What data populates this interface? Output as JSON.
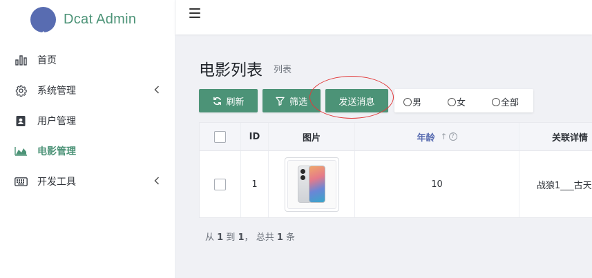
{
  "brand": {
    "name": "Dcat Admin"
  },
  "sidebar": {
    "items": [
      {
        "label": "首页",
        "icon": "bar-chart-icon",
        "active": false,
        "has_children": false
      },
      {
        "label": "系统管理",
        "icon": "gear-icon",
        "active": false,
        "has_children": true
      },
      {
        "label": "用户管理",
        "icon": "contact-book-icon",
        "active": false,
        "has_children": false
      },
      {
        "label": "电影管理",
        "icon": "area-chart-icon",
        "active": true,
        "has_children": false
      },
      {
        "label": "开发工具",
        "icon": "keyboard-icon",
        "active": false,
        "has_children": true
      }
    ]
  },
  "page": {
    "title": "电影列表",
    "subtitle": "列表"
  },
  "toolbar": {
    "refresh_label": "刷新",
    "filter_label": "筛选",
    "send_label": "发送消息",
    "radios": [
      "男",
      "女",
      "全部"
    ]
  },
  "table": {
    "headers": {
      "id": "ID",
      "image": "图片",
      "age": "年龄",
      "related": "关联详情"
    },
    "rows": [
      {
        "id": "1",
        "age": "10",
        "related": "战狼1___古天"
      }
    ]
  },
  "pagination": {
    "prefix": "从",
    "from": "1",
    "to_word": "到",
    "to": "1",
    "sep": "，",
    "total_word": "总共",
    "total": "1",
    "unit": "条"
  },
  "colors": {
    "primary": "#4c9377",
    "accent": "#586cb1",
    "annotation": "#e23a3a"
  }
}
